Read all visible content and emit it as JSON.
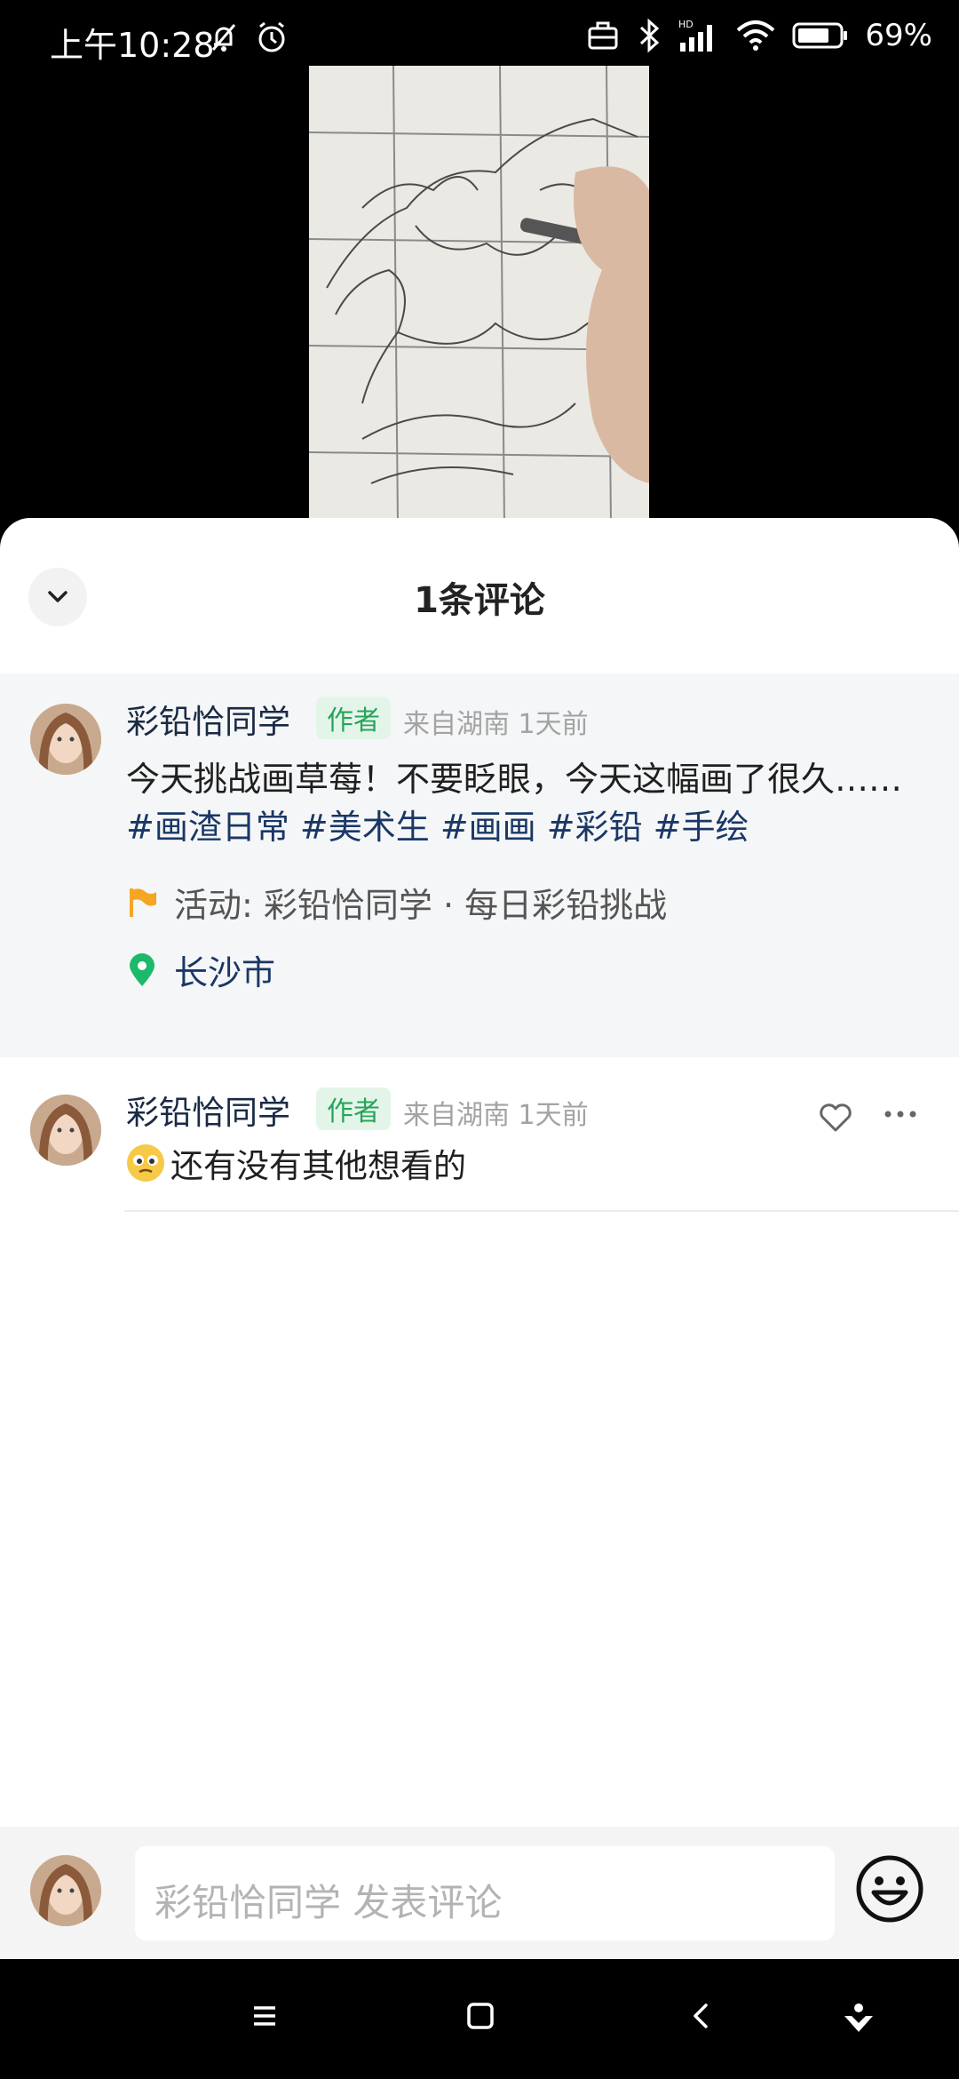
{
  "status_bar": {
    "time": "上午10:28",
    "battery": "69%"
  },
  "sheet": {
    "title": "1条评论",
    "post": {
      "username": "彩铅恰同学",
      "badge": "作者",
      "meta": "来自湖南 1天前",
      "text_plain": "今天挑战画草莓！不要眨眼，今天这幅画了很久……",
      "text_tags": "#画渣日常 #美术生 #画画 #彩铅 #手绘",
      "activity": "活动: 彩铅恰同学 · 每日彩铅挑战",
      "location": "长沙市"
    },
    "comment": {
      "username": "彩铅恰同学",
      "badge": "作者",
      "meta": "来自湖南 1天前",
      "text": "还有没有其他想看的"
    },
    "composer": {
      "placeholder": "彩铅恰同学 发表评论"
    }
  },
  "colors": {
    "accent_green": "#28a45a",
    "tag_blue": "#1a3766",
    "flag_orange": "#f5a623",
    "location_green": "#1db96a"
  }
}
